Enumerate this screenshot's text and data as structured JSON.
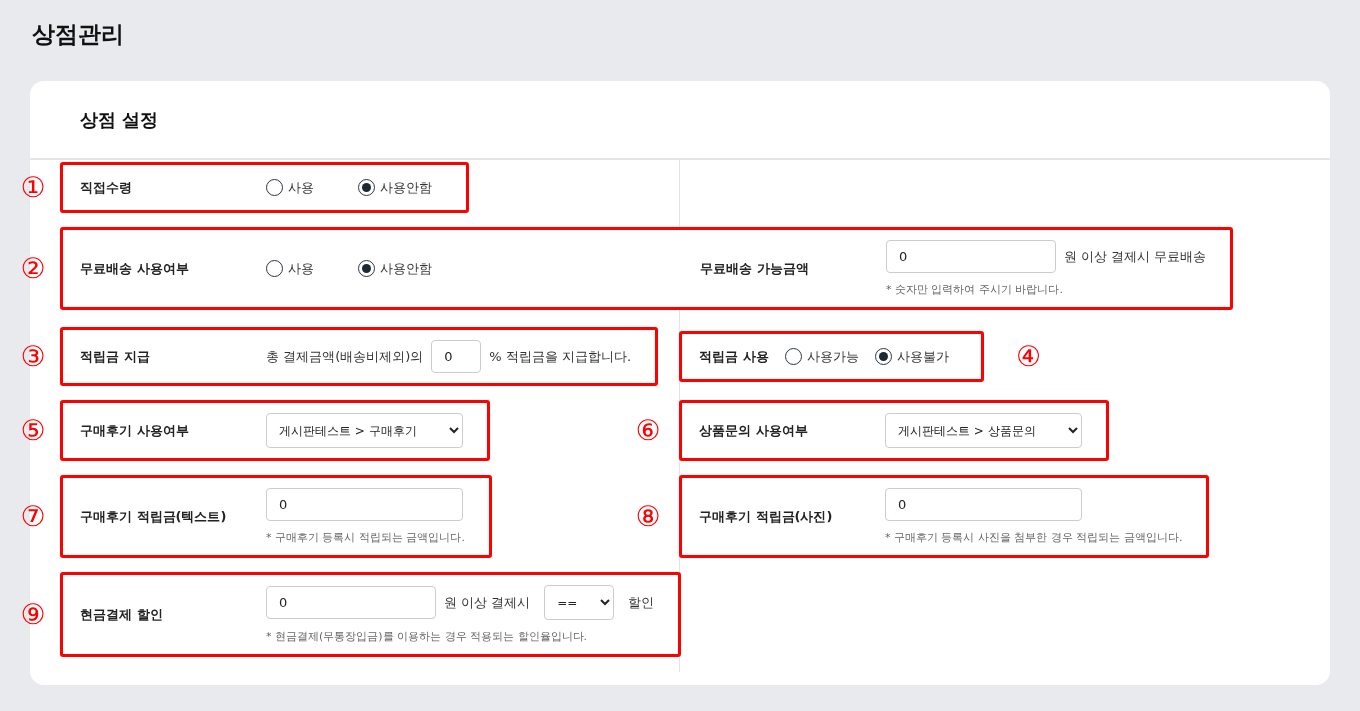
{
  "page_title": "상점관리",
  "card": {
    "title": "상점 설정",
    "rows": [
      {
        "items": [
          {
            "marker": "①",
            "settings": [
              {
                "label": "직접수령",
                "controls": [
                  {
                    "kind": "radio",
                    "label": "사용",
                    "selected": false
                  },
                  {
                    "kind": "radio",
                    "label": "사용안함",
                    "selected": true
                  }
                ]
              }
            ]
          }
        ]
      },
      {
        "items": [
          {
            "marker": "②",
            "settings": [
              {
                "label": "무료배송 사용여부",
                "controls": [
                  {
                    "kind": "radio",
                    "label": "사용",
                    "selected": false
                  },
                  {
                    "kind": "radio",
                    "label": "사용안함",
                    "selected": true
                  }
                ]
              },
              {
                "label": "무료배송 가능금액",
                "controls": [
                  {
                    "kind": "input",
                    "value": "0"
                  },
                  {
                    "kind": "text",
                    "text": "원 이상 결제시 무료배송"
                  }
                ],
                "hint": "* 숫자만 입력하여 주시기 바랍니다."
              }
            ]
          }
        ]
      },
      {
        "items": [
          {
            "marker": "③",
            "settings": [
              {
                "label": "적립금 지급",
                "controls": [
                  {
                    "kind": "text",
                    "text": "총 결제금액(배송비제외)의"
                  },
                  {
                    "kind": "input",
                    "value": "0"
                  },
                  {
                    "kind": "text",
                    "text": "% 적립금을 지급합니다."
                  }
                ]
              }
            ]
          },
          {
            "marker": "④",
            "settings": [
              {
                "label": "적립금 사용",
                "controls": [
                  {
                    "kind": "radio",
                    "label": "사용가능",
                    "selected": false
                  },
                  {
                    "kind": "radio",
                    "label": "사용불가",
                    "selected": true
                  }
                ]
              }
            ]
          }
        ]
      },
      {
        "items": [
          {
            "marker": "⑤",
            "settings": [
              {
                "label": "구매후기 사용여부",
                "controls": [
                  {
                    "kind": "select",
                    "value": "게시판테스트 > 구매후기"
                  }
                ]
              }
            ]
          },
          {
            "marker": "⑥",
            "settings": [
              {
                "label": "상품문의 사용여부",
                "controls": [
                  {
                    "kind": "select",
                    "value": "게시판테스트 > 상품문의"
                  }
                ]
              }
            ]
          }
        ]
      },
      {
        "items": [
          {
            "marker": "⑦",
            "settings": [
              {
                "label": "구매후기 적립금(텍스트)",
                "controls": [
                  {
                    "kind": "input",
                    "value": "0"
                  }
                ],
                "hint": "* 구매후기 등록시 적립되는 금액입니다."
              }
            ]
          },
          {
            "marker": "⑧",
            "settings": [
              {
                "label": "구매후기 적립금(사진)",
                "controls": [
                  {
                    "kind": "input",
                    "value": "0"
                  }
                ],
                "hint": "* 구매후기 등록시 사진을 첨부한 경우 적립되는 금액입니다."
              }
            ]
          }
        ]
      },
      {
        "items": [
          {
            "marker": "⑨",
            "settings": [
              {
                "label": "현금결제 할인",
                "controls": [
                  {
                    "kind": "input",
                    "value": "0"
                  },
                  {
                    "kind": "text",
                    "text": "원 이상 결제시"
                  },
                  {
                    "kind": "select",
                    "value": "=="
                  },
                  {
                    "kind": "text",
                    "text": "할인"
                  }
                ],
                "hint": "* 현금결제(무통장입금)를 이용하는 경우 적용되는 할인율입니다."
              }
            ]
          }
        ]
      }
    ]
  }
}
